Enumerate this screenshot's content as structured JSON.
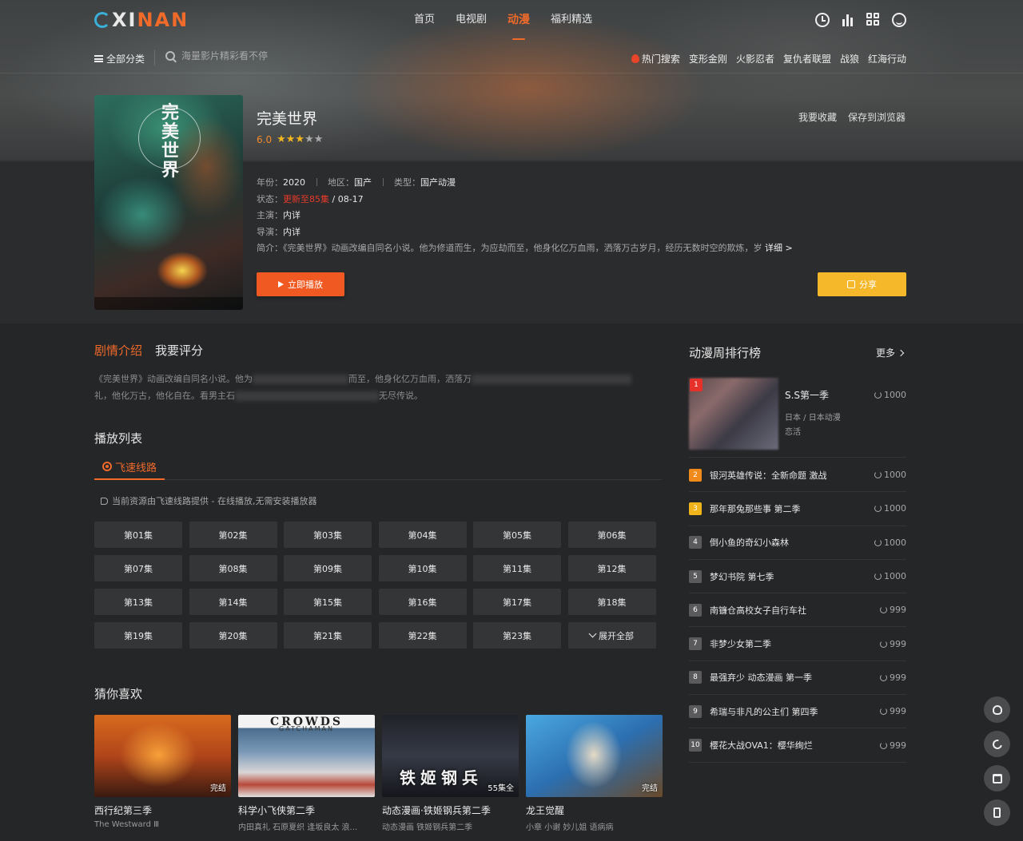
{
  "header": {
    "logo": {
      "mark": "C",
      "part1": "XI",
      "part2": "NAN"
    },
    "nav": [
      "首页",
      "电视剧",
      "动漫",
      "福利精选"
    ],
    "active_nav": "动漫",
    "icons": [
      "history-icon",
      "chart-icon",
      "grid-icon",
      "smile-icon"
    ]
  },
  "subbar": {
    "all_categories": "全部分类",
    "search_placeholder": "海量影片精彩看不停",
    "hot_label": "热门搜索",
    "hot_items": [
      "变形金刚",
      "火影忍者",
      "复仇者联盟",
      "战狼",
      "红海行动"
    ]
  },
  "detail": {
    "poster_title": "完美世界",
    "title": "完美世界",
    "score": "6.0",
    "stars_filled": 3,
    "stars_total": 5,
    "star_icons": {
      "filled": "★★★",
      "empty": "★★"
    },
    "actions": [
      "我要收藏",
      "保存到浏览器"
    ],
    "year_label": "年份：",
    "year": "2020",
    "region_label": "地区：",
    "region": "国产",
    "type_label": "类型：",
    "type": "国产动漫",
    "status_label": "状态：",
    "status": "更新至85集",
    "status_date": " / 08-17",
    "cast_label": "主演：",
    "cast": "内详",
    "director_label": "导演：",
    "director": "内详",
    "summary_label": "简介：",
    "summary": "《完美世界》动画改编自同名小说。他为修道而生，为应劫而至，他身化亿万血雨，洒落万古岁月，经历无数时空的欺炼，岁",
    "summary_more": "详细 >",
    "play_label": "立即播放",
    "share_label": "分享"
  },
  "intro": {
    "tabs": [
      "剧情介绍",
      "我要评分"
    ],
    "text_line1": "《完美世界》动画改编自同名小说。他为",
    "text_line1b": "而至，他身化亿万血雨，洒落万",
    "text_line2": "礼，他化万古，他化自在。看男主石",
    "text_line2b": "无尽传说。"
  },
  "playlist": {
    "title": "播放列表",
    "line_tab": "飞速线路",
    "source_tip": "当前资源由飞速线路提供 - 在线播放,无需安装播放器",
    "episodes": [
      "第01集",
      "第02集",
      "第03集",
      "第04集",
      "第05集",
      "第06集",
      "第07集",
      "第08集",
      "第09集",
      "第10集",
      "第11集",
      "第12集",
      "第13集",
      "第14集",
      "第15集",
      "第16集",
      "第17集",
      "第18集",
      "第19集",
      "第20集",
      "第21集",
      "第22集",
      "第23集"
    ],
    "expand_label": "展开全部"
  },
  "recommend": {
    "title": "猜你喜欢",
    "items": [
      {
        "name": "西行纪第三季",
        "sub": "The Westward Ⅲ",
        "badge": "完结"
      },
      {
        "name": "科学小飞侠第二季",
        "sub": "内田真礼 石原夏织 逢坂良太 浪...",
        "badge": ""
      },
      {
        "name": "动态漫画·铁姬钢兵第二季",
        "sub": "动态漫画 铁姬钢兵第二季",
        "badge": "55集全"
      },
      {
        "name": "龙王觉醒",
        "sub": "小章 小谢 妙儿姐 语病病",
        "badge": "完结"
      }
    ],
    "gatch_title": "CROWDS",
    "gatch_sub": "GATCHAMAN",
    "tiehe_text": "铁姬钢兵"
  },
  "ranking": {
    "title": "动漫周排行榜",
    "more": "更多",
    "first": {
      "num": "1",
      "name": "S.S第一季",
      "sub1": "日本 / 日本动漫",
      "sub2": "恋活",
      "count": "1000"
    },
    "rows": [
      {
        "num": "2",
        "name": "银河英雄传说：全新命题 激战",
        "count": "1000"
      },
      {
        "num": "3",
        "name": "那年那兔那些事 第二季",
        "count": "1000"
      },
      {
        "num": "4",
        "name": "倒小鱼的奇幻小森林",
        "count": "1000"
      },
      {
        "num": "5",
        "name": "梦幻书院 第七季",
        "count": "1000"
      },
      {
        "num": "6",
        "name": "南镰仓高校女子自行车社",
        "count": "999"
      },
      {
        "num": "7",
        "name": "非梦少女第二季",
        "count": "999"
      },
      {
        "num": "8",
        "name": "最强弃少 动态漫画 第一季",
        "count": "999"
      },
      {
        "num": "9",
        "name": "希瑞与非凡的公主们 第四季",
        "count": "999"
      },
      {
        "num": "10",
        "name": "樱花大战OVA1：樱华绚烂",
        "count": "999"
      }
    ]
  },
  "side_tools": [
    "qq-icon",
    "moon-icon",
    "shirt-icon",
    "phone-icon"
  ]
}
